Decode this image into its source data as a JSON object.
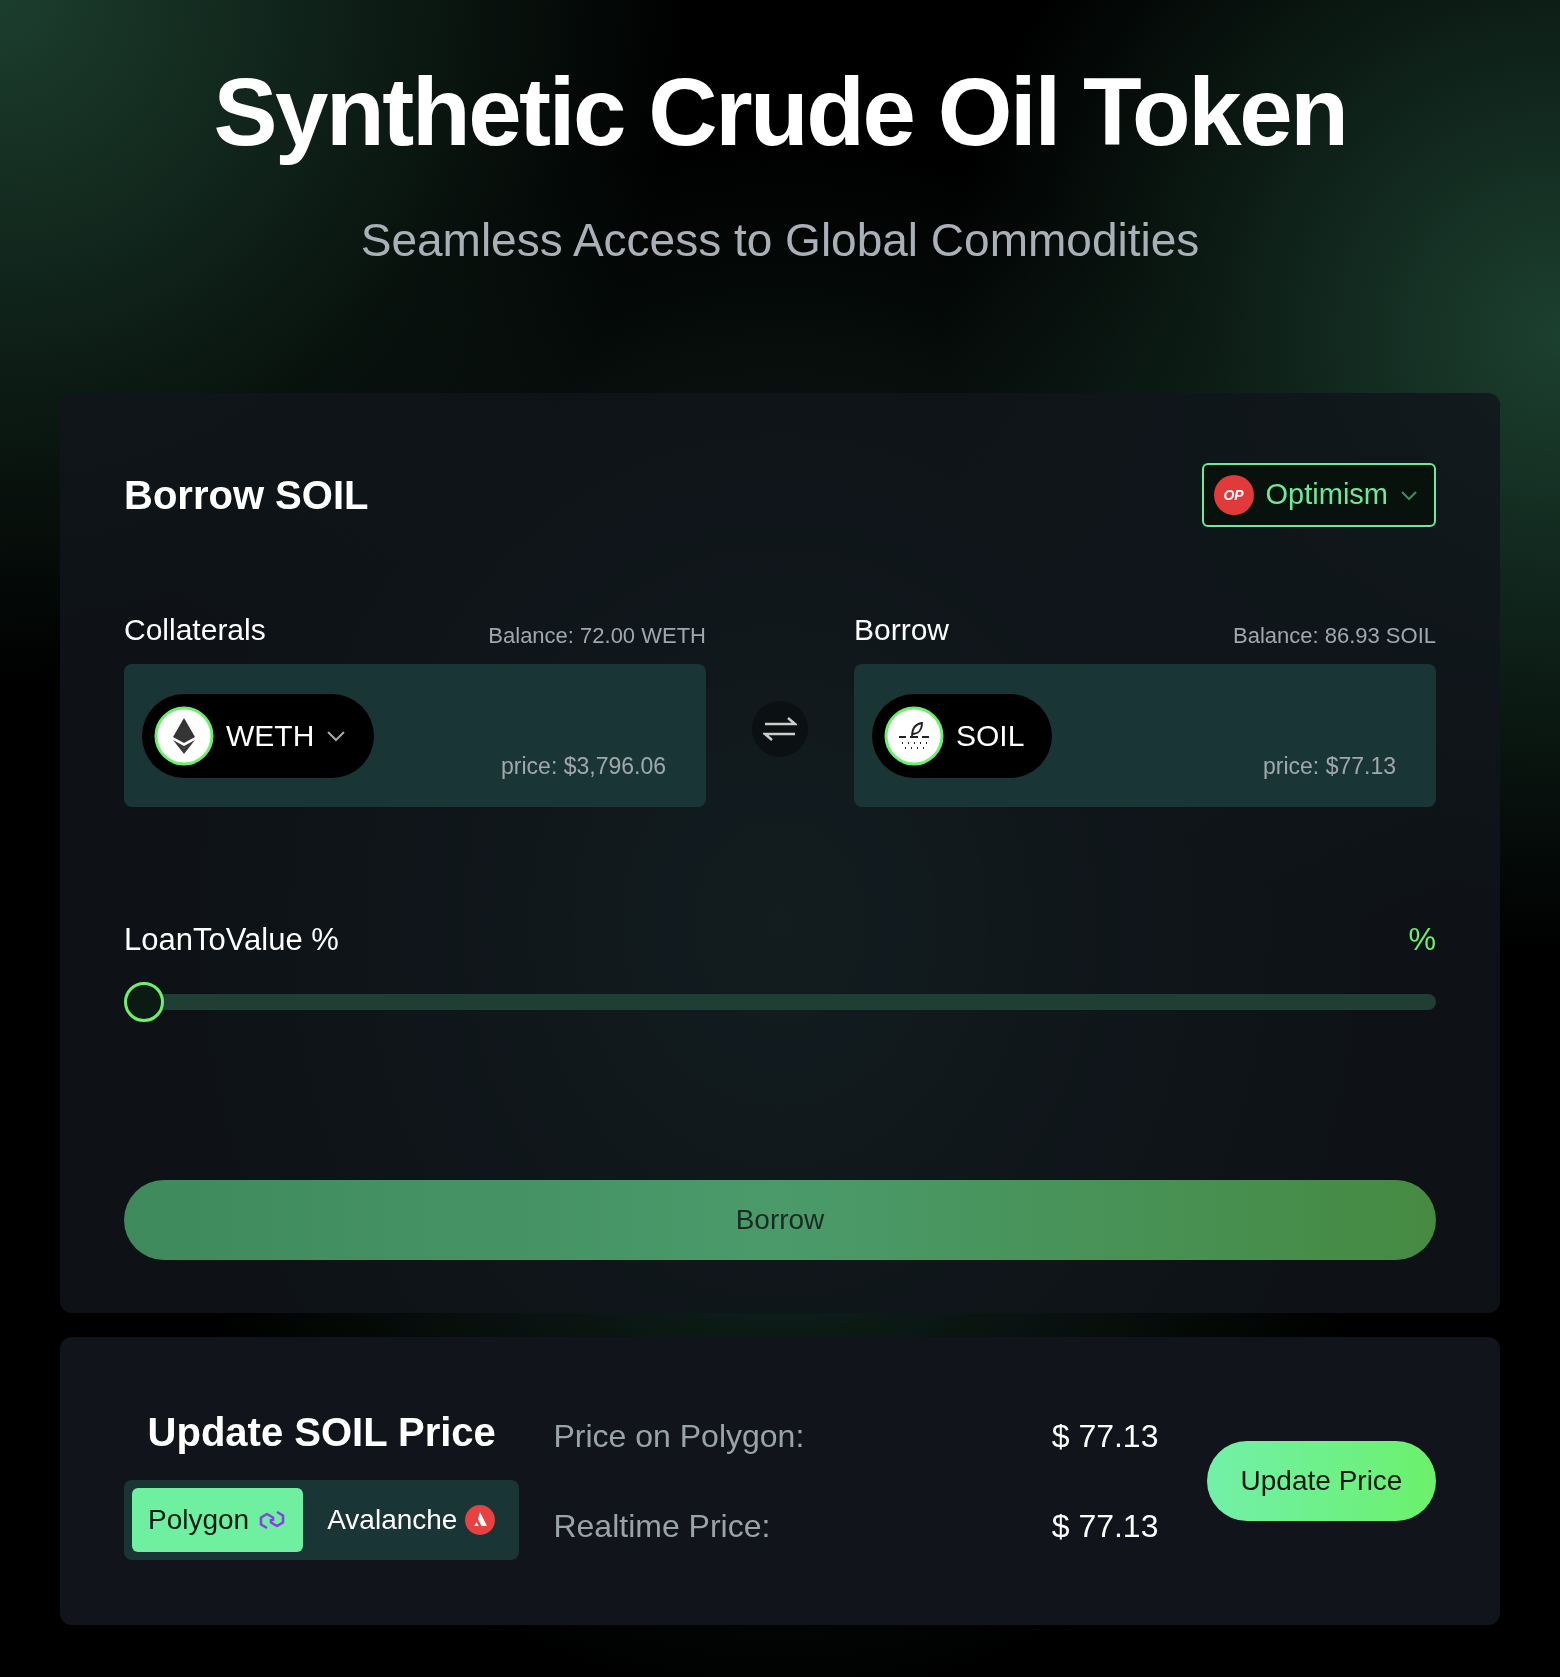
{
  "header": {
    "title": "Synthetic Crude Oil Token",
    "subtitle": "Seamless Access to Global Commodities"
  },
  "borrow_card": {
    "title": "Borrow SOIL",
    "network": {
      "badge": "OP",
      "label": "Optimism"
    },
    "collateral": {
      "label": "Collaterals",
      "balance": "Balance: 72.00 WETH",
      "token": "WETH",
      "price": "price: $3,796.06"
    },
    "borrow": {
      "label": "Borrow",
      "balance": "Balance: 86.93 SOIL",
      "token": "SOIL",
      "price": "price: $77.13"
    },
    "ltv": {
      "label": "LoanToValue %",
      "reading": "%",
      "level": 0
    },
    "button": "Borrow"
  },
  "price_card": {
    "title": "Update SOIL Price",
    "chains": [
      {
        "label": "Polygon",
        "kind": "polygon",
        "selected": true
      },
      {
        "label": "Avalanche",
        "kind": "avalanche",
        "selected": false
      }
    ],
    "rows": [
      {
        "label": "Price on Polygon:",
        "value": "$ 77.13"
      },
      {
        "label": "Realtime Price:",
        "value": "$ 77.13"
      }
    ],
    "button": "Update Price"
  }
}
